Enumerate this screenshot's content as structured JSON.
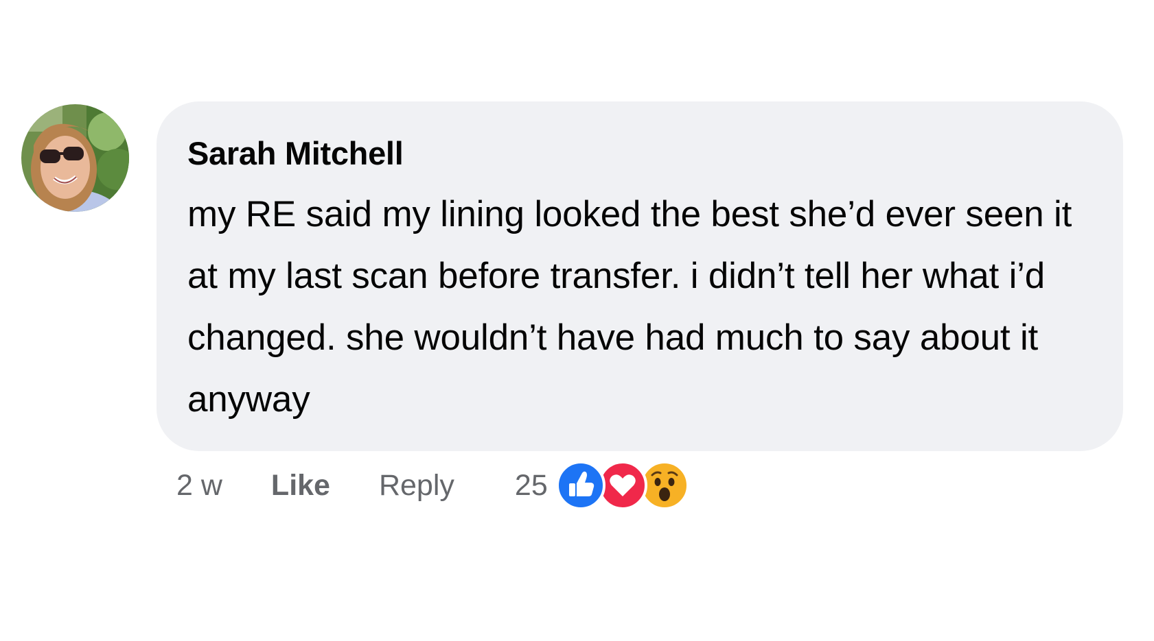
{
  "comment": {
    "author": "Sarah Mitchell",
    "text": "my RE said my lining looked the best she’d ever seen it at my last scan before transfer. i didn’t tell her what i’d changed. she wouldn’t have had much to say about it anyway",
    "timestamp": "2 w",
    "like_label": "Like",
    "reply_label": "Reply",
    "reaction_count": "25",
    "reactions": [
      "like-icon",
      "love-icon",
      "wow-icon"
    ]
  },
  "colors": {
    "bubble_bg": "#f0f1f4",
    "meta_text": "#65676b",
    "like_blue": "#1d74f5",
    "love_red": "#f0284a",
    "wow_yellow": "#f7b125"
  }
}
